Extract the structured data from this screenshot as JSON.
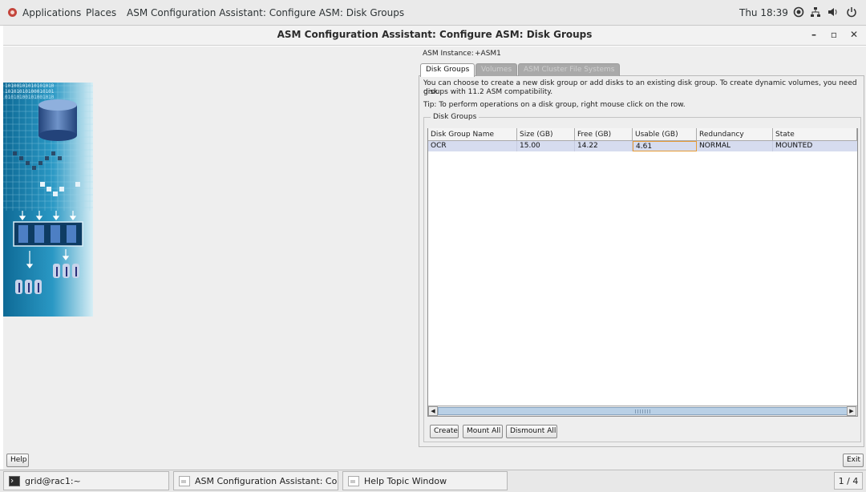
{
  "topbar": {
    "applications": "Applications",
    "places": "Places",
    "active_window": "ASM Configuration Assistant: Configure ASM: Disk Groups",
    "clock": "Thu 18:39",
    "icons": [
      "accessibility-icon",
      "network-icon",
      "volume-icon",
      "power-icon"
    ]
  },
  "window": {
    "title": "ASM Configuration Assistant: Configure ASM: Disk Groups",
    "controls": {
      "minimize": "–",
      "maximize": "▫",
      "close": "✕"
    }
  },
  "asm": {
    "instance_label": "ASM Instance:",
    "instance_value": "+ASM1"
  },
  "tabs": [
    {
      "label": "Disk Groups",
      "state": "active"
    },
    {
      "label": "Volumes",
      "state": "disabled"
    },
    {
      "label": "ASM Cluster File Systems",
      "state": "disabled"
    }
  ],
  "info": {
    "line1": "You can choose to create a new disk group or add disks to an existing disk group. To create dynamic volumes, you need disk",
    "line2": "groups with 11.2 ASM compatibility.",
    "tip": "Tip: To perform operations on a disk group, right mouse click on the row."
  },
  "disk_groups": {
    "title": "Disk Groups",
    "columns": [
      "Disk Group Name",
      "Size (GB)",
      "Free (GB)",
      "Usable (GB)",
      "Redundancy",
      "State"
    ],
    "rows": [
      [
        "OCR",
        "15.00",
        "14.22",
        "4.61",
        "NORMAL",
        "MOUNTED"
      ]
    ]
  },
  "buttons": {
    "create": "Create",
    "mount_all": "Mount All",
    "dismount_all": "Dismount All",
    "help": "Help",
    "exit": "Exit"
  },
  "taskbar": {
    "items": [
      {
        "label": "grid@rac1:~",
        "icon": "terminal-icon"
      },
      {
        "label": "ASM Configuration Assistant: Config...",
        "icon": "java-app-icon"
      },
      {
        "label": "Help Topic Window",
        "icon": "java-app-icon"
      }
    ],
    "workspace": "1 / 4"
  },
  "colors": {
    "selected_row": "#d6dcef",
    "focus_cell": "#e59a36",
    "art_blue": "#1d6fa3"
  }
}
